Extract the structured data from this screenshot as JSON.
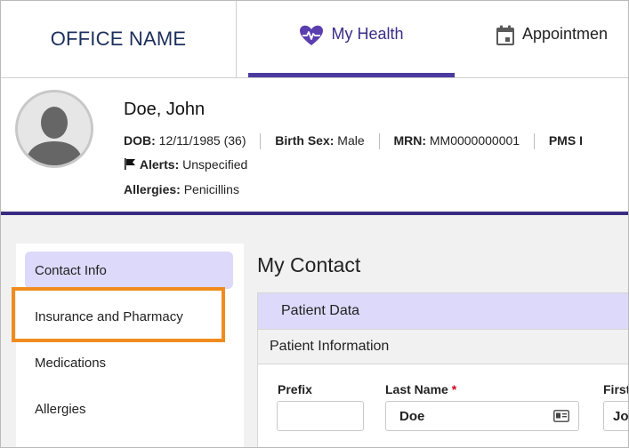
{
  "office": {
    "name": "OFFICE NAME"
  },
  "nav": {
    "tabs": [
      {
        "label": "My Health",
        "icon": "heart-pulse-icon",
        "active": true
      },
      {
        "label": "Appointmen",
        "icon": "calendar-icon",
        "active": false
      }
    ]
  },
  "patient": {
    "name": "Doe, John",
    "dob_label": "DOB:",
    "dob_value": "12/11/1985 (36)",
    "sex_label": "Birth Sex:",
    "sex_value": "Male",
    "mrn_label": "MRN:",
    "mrn_value": "MM0000000001",
    "pms_label": "PMS I",
    "alerts_label": "Alerts:",
    "alerts_value": "Unspecified",
    "allergies_label": "Allergies:",
    "allergies_value": "Penicillins"
  },
  "sidebar": {
    "items": [
      {
        "label": "Contact Info",
        "active": true
      },
      {
        "label": "Insurance and Pharmacy",
        "active": false
      },
      {
        "label": "Medications",
        "active": false
      },
      {
        "label": "Allergies",
        "active": false
      }
    ]
  },
  "main": {
    "title": "My Contact",
    "panel_title": "Patient Data",
    "section_title": "Patient Information",
    "fields": {
      "prefix": {
        "label": "Prefix",
        "value": ""
      },
      "last_name": {
        "label": "Last Name",
        "required_mark": "*",
        "value": "Doe"
      },
      "first_name": {
        "label": "First",
        "value": "Jo"
      }
    }
  },
  "colors": {
    "accent": "#4b3aa0",
    "active_bg": "#dcd9fa",
    "highlight": "#f08c1e",
    "required": "#d0021b"
  }
}
